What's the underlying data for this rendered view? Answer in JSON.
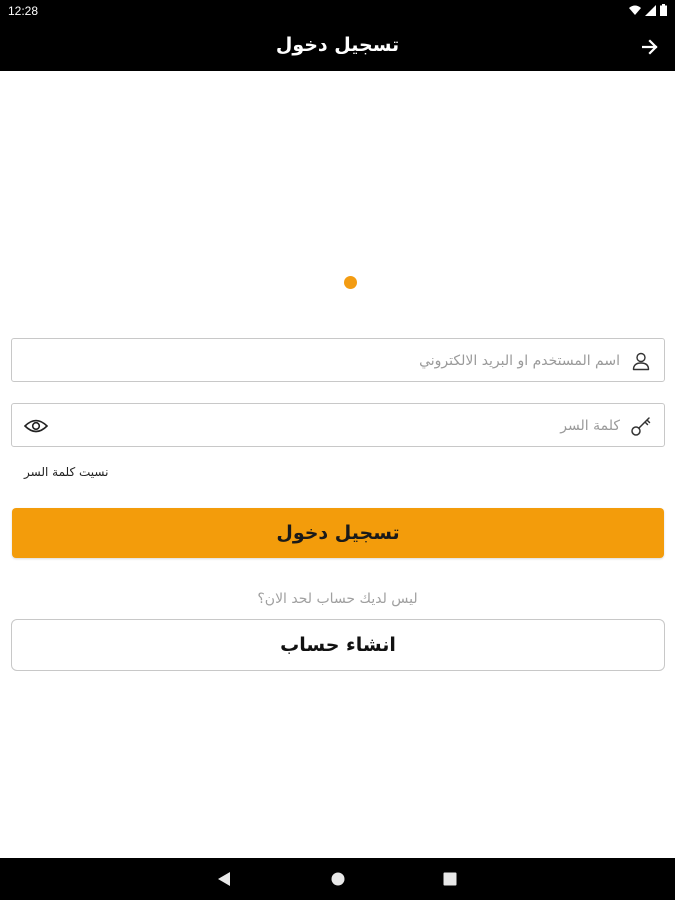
{
  "status_bar": {
    "time": "12:28",
    "icons": [
      "wifi-icon",
      "signal-icon",
      "battery-icon"
    ]
  },
  "app_bar": {
    "title": "تسجيل دخول",
    "back_icon": "arrow-right-icon"
  },
  "form": {
    "username": {
      "placeholder": "اسم المستخدم او البريد الالكتروني",
      "value": "",
      "icon": "user-icon"
    },
    "password": {
      "placeholder": "كلمة السر",
      "value": "",
      "icon": "key-icon",
      "toggle_icon": "eye-icon"
    },
    "forgot_password": "نسيت كلمة السر",
    "login_label": "تسجيل دخول",
    "no_account_text": "ليس لديك حساب لحد الان؟",
    "create_account_label": "انشاء حساب"
  },
  "colors": {
    "accent": "#f39c0b",
    "loading_dot": "#f39c12",
    "bars": "#000000"
  },
  "nav_bar": {
    "icons": [
      "back-triangle-icon",
      "home-circle-icon",
      "recents-square-icon"
    ]
  }
}
